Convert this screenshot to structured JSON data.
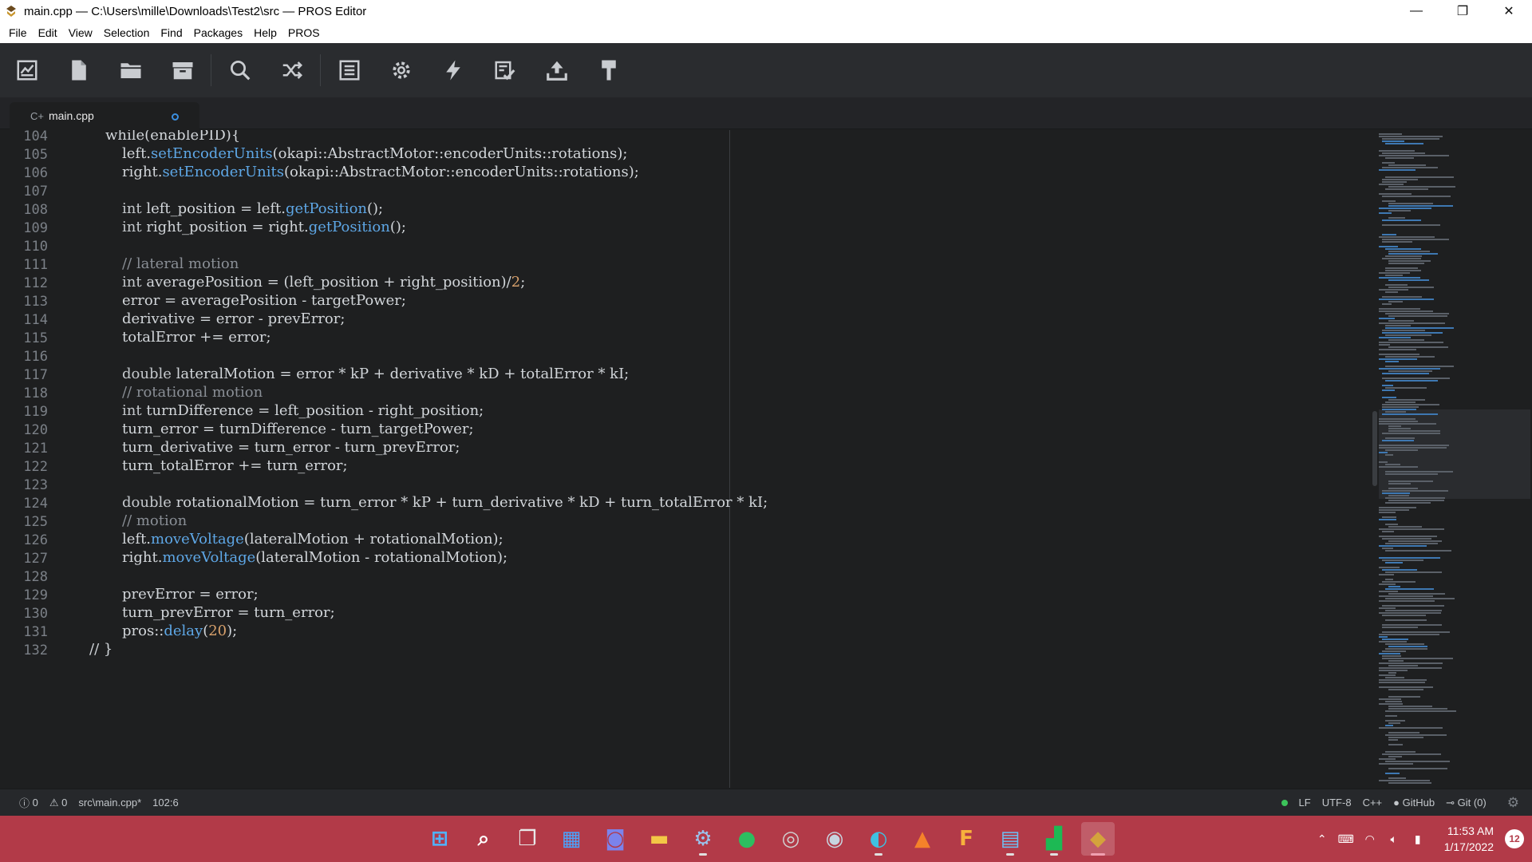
{
  "window": {
    "title": "main.cpp — C:\\Users\\mille\\Downloads\\Test2\\src — PROS Editor",
    "minimize_glyph": "—",
    "restore_glyph": "❐",
    "close_glyph": "✕"
  },
  "menu": [
    "File",
    "Edit",
    "View",
    "Selection",
    "Find",
    "Packages",
    "Help",
    "PROS"
  ],
  "toolbar": {
    "buttons": [
      "project-icon",
      "new-file-icon",
      "open-folder-icon",
      "archive-icon",
      "search-icon",
      "shuffle-icon",
      "list-icon",
      "gear-icon",
      "bolt-icon",
      "checklist-icon",
      "upload-icon",
      "paint-roller-icon"
    ]
  },
  "tab": {
    "title": "main.cpp",
    "icon": "C+"
  },
  "editor": {
    "lines": [
      {
        "n": "104",
        "indent": 1,
        "segs": [
          [
            "t",
            "while(enablePID){"
          ]
        ]
      },
      {
        "n": "105",
        "indent": 2,
        "segs": [
          [
            "t",
            "left."
          ],
          [
            "fn",
            "setEncoderUnits"
          ],
          [
            "t",
            "(okapi::AbstractMotor::encoderUnits::rotations);"
          ]
        ]
      },
      {
        "n": "106",
        "indent": 2,
        "segs": [
          [
            "t",
            "right."
          ],
          [
            "fn",
            "setEncoderUnits"
          ],
          [
            "t",
            "(okapi::AbstractMotor::encoderUnits::rotations);"
          ]
        ]
      },
      {
        "n": "107",
        "indent": 0,
        "segs": []
      },
      {
        "n": "108",
        "indent": 2,
        "segs": [
          [
            "kw",
            "int"
          ],
          [
            "t",
            " left_position = left."
          ],
          [
            "fn",
            "getPosition"
          ],
          [
            "t",
            "();"
          ]
        ]
      },
      {
        "n": "109",
        "indent": 2,
        "segs": [
          [
            "kw",
            "int"
          ],
          [
            "t",
            " right_position = right."
          ],
          [
            "fn",
            "getPosition"
          ],
          [
            "t",
            "();"
          ]
        ]
      },
      {
        "n": "110",
        "indent": 0,
        "segs": []
      },
      {
        "n": "111",
        "indent": 2,
        "segs": [
          [
            "cm",
            "// lateral motion"
          ]
        ]
      },
      {
        "n": "112",
        "indent": 2,
        "segs": [
          [
            "kw",
            "int"
          ],
          [
            "t",
            " averagePosition = (left_position + right_position)/"
          ],
          [
            "num",
            "2"
          ],
          [
            "t",
            ";"
          ]
        ]
      },
      {
        "n": "113",
        "indent": 2,
        "segs": [
          [
            "t",
            "error = averagePosition - targetPower;"
          ]
        ]
      },
      {
        "n": "114",
        "indent": 2,
        "segs": [
          [
            "t",
            "derivative = error - prevError;"
          ]
        ]
      },
      {
        "n": "115",
        "indent": 2,
        "segs": [
          [
            "t",
            "totalError += error;"
          ]
        ]
      },
      {
        "n": "116",
        "indent": 0,
        "segs": []
      },
      {
        "n": "117",
        "indent": 2,
        "segs": [
          [
            "kw",
            "double"
          ],
          [
            "t",
            " lateralMotion = error * kP + derivative * kD + totalError * kI;"
          ]
        ]
      },
      {
        "n": "118",
        "indent": 2,
        "segs": [
          [
            "cm",
            "// rotational motion"
          ]
        ]
      },
      {
        "n": "119",
        "indent": 2,
        "segs": [
          [
            "kw",
            "int"
          ],
          [
            "t",
            " turnDifference = left_position - right_position;"
          ]
        ]
      },
      {
        "n": "120",
        "indent": 2,
        "segs": [
          [
            "t",
            "turn_error = turnDifference - turn_targetPower;"
          ]
        ]
      },
      {
        "n": "121",
        "indent": 2,
        "segs": [
          [
            "t",
            "turn_derivative = turn_error - turn_prevError;"
          ]
        ]
      },
      {
        "n": "122",
        "indent": 2,
        "segs": [
          [
            "t",
            "turn_totalError += turn_error;"
          ]
        ]
      },
      {
        "n": "123",
        "indent": 0,
        "segs": []
      },
      {
        "n": "124",
        "indent": 2,
        "segs": [
          [
            "kw",
            "double"
          ],
          [
            "t",
            " rotationalMotion = turn_error * kP + turn_derivative * kD + turn_totalError * kI;"
          ]
        ]
      },
      {
        "n": "125",
        "indent": 2,
        "segs": [
          [
            "cm",
            "// motion"
          ]
        ]
      },
      {
        "n": "126",
        "indent": 2,
        "segs": [
          [
            "t",
            "left."
          ],
          [
            "fn",
            "moveVoltage"
          ],
          [
            "t",
            "(lateralMotion + rotationalMotion);"
          ]
        ]
      },
      {
        "n": "127",
        "indent": 2,
        "segs": [
          [
            "t",
            "right."
          ],
          [
            "fn",
            "moveVoltage"
          ],
          [
            "t",
            "(lateralMotion - rotationalMotion);"
          ]
        ]
      },
      {
        "n": "128",
        "indent": 0,
        "segs": []
      },
      {
        "n": "129",
        "indent": 2,
        "segs": [
          [
            "t",
            "prevError = error;"
          ]
        ]
      },
      {
        "n": "130",
        "indent": 2,
        "segs": [
          [
            "t",
            "turn_prevError = turn_error;"
          ]
        ]
      },
      {
        "n": "131",
        "indent": 2,
        "segs": [
          [
            "t",
            "pros::"
          ],
          [
            "fn",
            "delay"
          ],
          [
            "t",
            "("
          ],
          [
            "num",
            "20"
          ],
          [
            "t",
            ");"
          ]
        ]
      },
      {
        "n": "132",
        "indent": 0,
        "segs": [
          [
            "t",
            "// }"
          ]
        ]
      }
    ]
  },
  "status": {
    "errors": "0",
    "warnings": "0",
    "file": "src\\main.cpp*",
    "cursor": "102:6",
    "line_ending": "LF",
    "encoding": "UTF-8",
    "grammar": "C++",
    "github": "GitHub",
    "git": "Git (0)"
  },
  "taskbar": {
    "apps": [
      "start-icon",
      "search-icon",
      "task-view-icon",
      "widgets-icon",
      "teams-chat-icon",
      "file-explorer-icon",
      "settings-icon",
      "evernote-icon",
      "disc-icon",
      "steam-icon",
      "edge-icon",
      "matlab-icon",
      "f-app-icon",
      "notepad-icon",
      "stocks-icon",
      "pros-editor-icon"
    ],
    "active_app": "pros-editor-icon",
    "time": "11:53 AM",
    "date": "1/17/2022",
    "notifications": "12"
  }
}
